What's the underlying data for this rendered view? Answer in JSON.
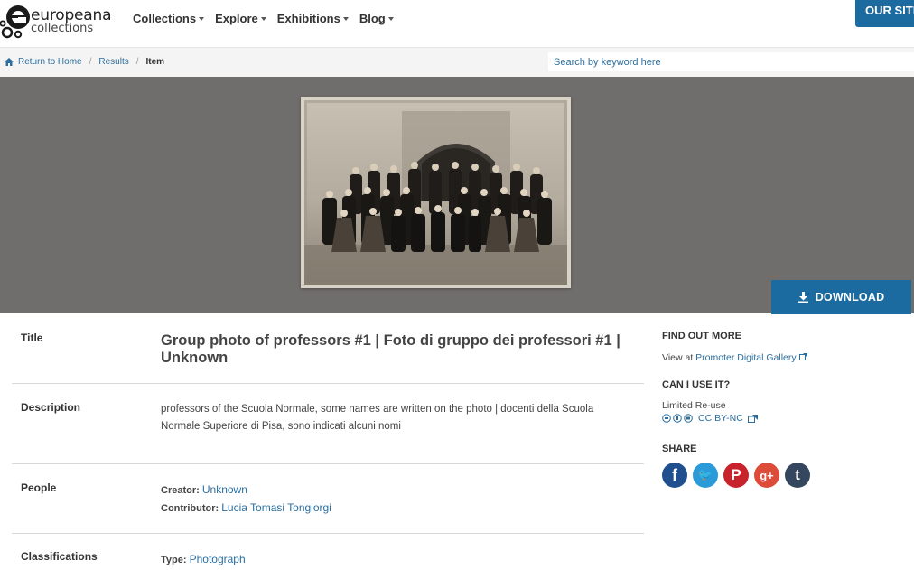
{
  "header": {
    "logo_line1": "europeana",
    "logo_line2": "collections",
    "nav": [
      {
        "label": "Collections"
      },
      {
        "label": "Explore"
      },
      {
        "label": "Exhibitions"
      },
      {
        "label": "Blog"
      }
    ],
    "our_site": "OUR SITE"
  },
  "breadcrumb": {
    "home": "Return to Home",
    "results": "Results",
    "current": "Item",
    "separator": "/"
  },
  "search": {
    "placeholder": "Search by keyword here"
  },
  "viewer": {
    "download_label": "DOWNLOAD"
  },
  "details": {
    "title_label": "Title",
    "title": "Group photo of professors #1 | Foto di gruppo dei professori #1 | Unknown",
    "description_label": "Description",
    "description": "professors of the Scuola Normale, some names are written on the photo | docenti della Scuola Normale Superiore di Pisa, sono indicati alcuni nomi",
    "people_label": "People",
    "creator_key": "Creator:",
    "creator": "Unknown",
    "contributor_key": "Contributor:",
    "contributor": "Lucia Tomasi Tongiorgi",
    "classifications_label": "Classifications",
    "type_key": "Type:",
    "type": "Photograph"
  },
  "side": {
    "find_out_more": "FIND OUT MORE",
    "view_at": "View at",
    "view_at_link": "Promoter Digital Gallery",
    "can_i_use": "CAN I USE IT?",
    "rights": "Limited Re-use",
    "license": "CC BY-NC",
    "share": "SHARE",
    "share_icons": [
      {
        "name": "facebook",
        "color": "#1f4f8f",
        "glyph": "f"
      },
      {
        "name": "twitter",
        "color": "#2a9ad8",
        "glyph": "🐦"
      },
      {
        "name": "pinterest",
        "color": "#c8232c",
        "glyph": "P"
      },
      {
        "name": "google-plus",
        "color": "#dd4b39",
        "glyph": "g+"
      },
      {
        "name": "tumblr",
        "color": "#34475e",
        "glyph": "t"
      }
    ]
  },
  "colors": {
    "accent": "#1b6ba1",
    "link": "#2c6e9e",
    "viewer_bg": "#706d6d"
  }
}
